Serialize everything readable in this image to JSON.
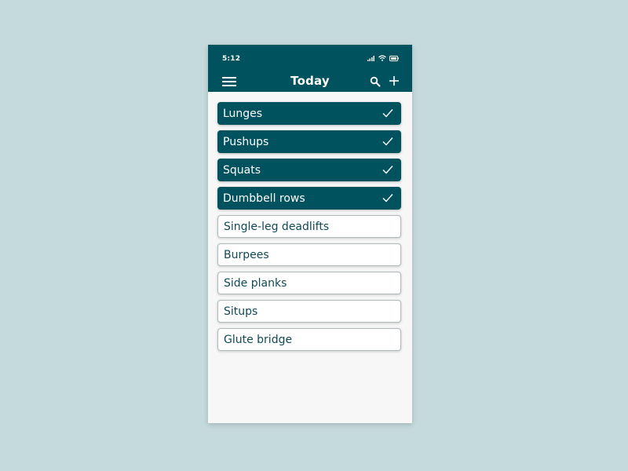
{
  "status_bar": {
    "time": "5:12",
    "icons": [
      "signal-icon",
      "wifi-icon",
      "battery-icon"
    ]
  },
  "app_bar": {
    "title": "Today",
    "menu_icon": "menu-icon",
    "search_icon": "search-icon",
    "add_icon": "plus-icon"
  },
  "colors": {
    "background": "#c5dadd",
    "primary": "#00525e",
    "surface": "#f7f7f7",
    "item_text": "#0f4a55"
  },
  "exercises": [
    {
      "label": "Lunges",
      "done": true
    },
    {
      "label": "Pushups",
      "done": true
    },
    {
      "label": "Squats",
      "done": true
    },
    {
      "label": "Dumbbell rows",
      "done": true
    },
    {
      "label": "Single-leg deadlifts",
      "done": false
    },
    {
      "label": "Burpees",
      "done": false
    },
    {
      "label": "Side planks",
      "done": false
    },
    {
      "label": "Situps",
      "done": false
    },
    {
      "label": "Glute bridge",
      "done": false
    }
  ]
}
